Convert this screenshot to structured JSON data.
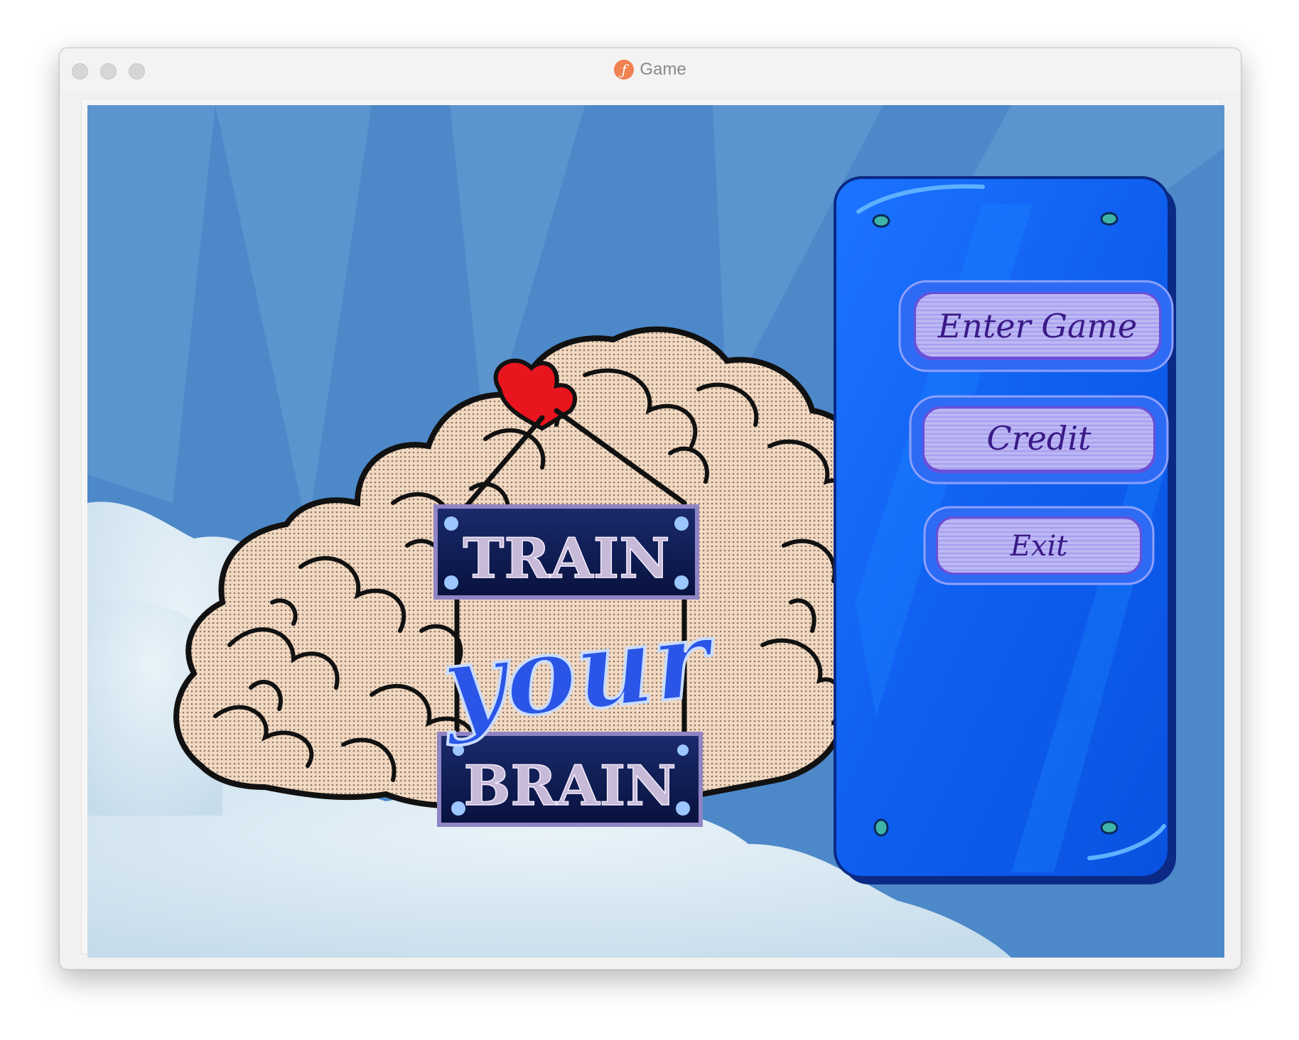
{
  "window": {
    "title": "Game",
    "app_icon": "flash-player-icon"
  },
  "logo": {
    "line1": "TRAIN",
    "line2": "your",
    "line3": "BRAIN"
  },
  "menu": {
    "items": [
      {
        "label": "Enter Game"
      },
      {
        "label": "Credit"
      },
      {
        "label": "Exit"
      }
    ]
  },
  "colors": {
    "sky": "#4d88c8",
    "panel": "#1664f2",
    "button": "#b6b2f0",
    "button_text": "#3a1a86",
    "sign": "#0f1c52",
    "sign_text": "#c7b9d8",
    "brain": "#f6dcc4",
    "heart": "#e8141e",
    "script": "#2a55e6"
  }
}
